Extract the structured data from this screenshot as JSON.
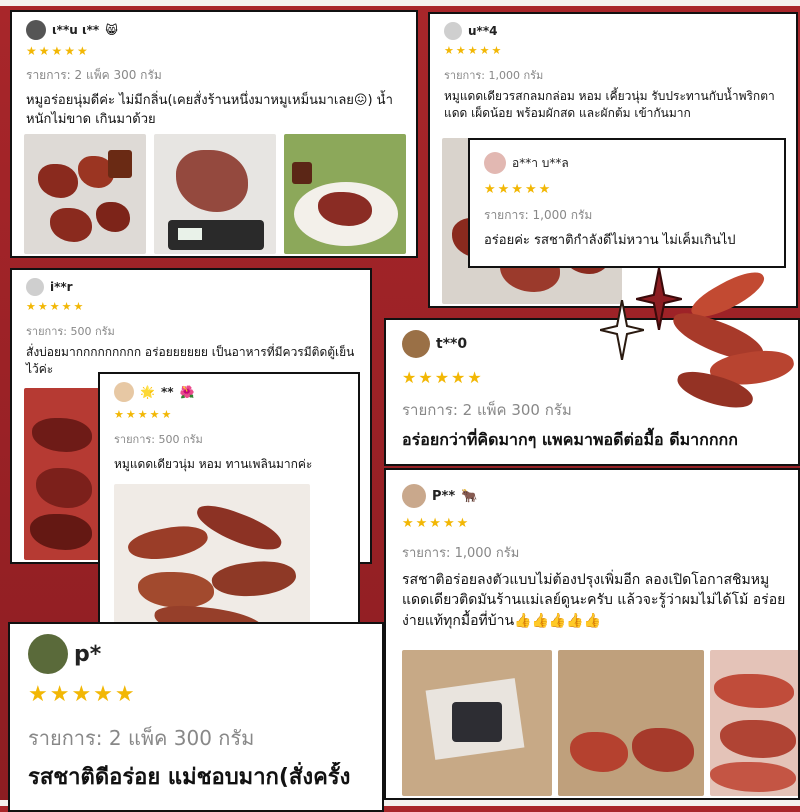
{
  "colors": {
    "background": "#8d1d22",
    "star": "#f2b705",
    "card": "#ffffff",
    "border": "#111111"
  },
  "stars": "★★★★★",
  "reviews": [
    {
      "user": "ι**u ι**",
      "emoji": "😸",
      "item": "รายการ: 2 แพ็ค 300 กรัม",
      "text": "หมูอร่อยนุ่มดีค่ะ ไม่มีกลิ่น(เคยสั่งร้านหนึ่งมาหมูเหม็นมาเลย😖) น้ำหนักไม่ขาด เกินมาด้วย"
    },
    {
      "user": "u**4",
      "emoji": "",
      "item": "รายการ: 1,000 กรัม",
      "text": "หมูแดดเดียวรสกลมกล่อม หอม เคี้ยวนุ่ม รับประทานกับน้ำพริกตาแดด เผ็ดน้อย พร้อมผักสด และผักต้ม เข้ากันมาก"
    },
    {
      "user": "อ**า บ**ล",
      "emoji": "",
      "item": "รายการ: 1,000 กรัม",
      "text": "อร่อยค่ะ รสชาติกำลังดีไม่หวาน ไม่เค็มเกินไป"
    },
    {
      "user": "i**r",
      "emoji": "",
      "item": "รายการ: 500 กรัม",
      "text": "สั่งบ่อยมากกกกกกกกก อร่อยยยยยย เป็นอาหารที่มีควรมีติดตู้เย็นไว้ค่ะ"
    },
    {
      "user": "t**0",
      "emoji": "",
      "item": "รายการ: 2 แพ็ค 300 กรัม",
      "text": "อร่อยกว่าที่คิดมากๆ แพคมาพอดีต่อมื้อ ดีมากกกก"
    },
    {
      "user": "**",
      "emoji_before": "🌟",
      "emoji": "🌺",
      "item": "รายการ: 500 กรัม",
      "text": "หมูแดดเดียวนุ่ม หอม ทานเพลินมากค่ะ"
    },
    {
      "user": "P**",
      "emoji": "🐂",
      "item": "รายการ: 1,000 กรัม",
      "text": "รสชาติอร่อยลงตัวแบบไม่ต้องปรุงเพิ่มอีก ลองเปิดโอกาสชิมหมูแดดเดียวติดมันร้านแม่เลย์ดูนะครับ แล้วจะรู้ว่าผมไม่ได้โม้ อร่อยง่ายแท้ทุกมื้อที่บ้าน👍👍👍👍👍"
    },
    {
      "user": "p*",
      "emoji": "",
      "item": "รายการ: 2 แพ็ค 300 กรัม",
      "text": "รสชาติดีอร่อย แม่ชอบมาก(สั่งครั้ง"
    }
  ]
}
